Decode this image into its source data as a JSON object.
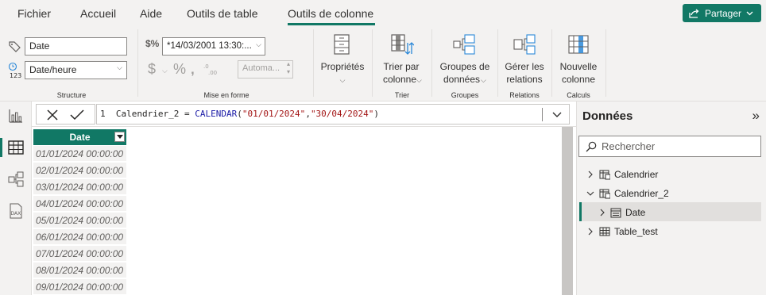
{
  "tabs": [
    "Fichier",
    "Accueil",
    "Aide",
    "Outils de table",
    "Outils de colonne"
  ],
  "share_label": "Partager",
  "structure": {
    "name_value": "Date",
    "type_value": "Date/heure",
    "group_label": "Structure"
  },
  "format": {
    "format_value": "*14/03/2001 13:30:...",
    "decimals_placeholder": "Automa...",
    "group_label": "Mise en forme"
  },
  "ribbon_buttons": {
    "properties": "Propriétés",
    "sort_line1": "Trier par",
    "sort_line2": "colonne",
    "sort_group": "Trier",
    "groups_line1": "Groupes de",
    "groups_line2": "données",
    "groups_group": "Groupes",
    "relations_line1": "Gérer les",
    "relations_line2": "relations",
    "relations_group": "Relations",
    "newcol_line1": "Nouvelle",
    "newcol_line2": "colonne",
    "calc_group": "Calculs"
  },
  "formula": {
    "line_no": "1",
    "prefix": "Calendrier_2 = ",
    "func": "CALENDAR",
    "open": "(",
    "arg1": "\"01/01/2024\"",
    "comma": ",",
    "arg2": "\"30/04/2024\"",
    "close": ")"
  },
  "grid": {
    "column": "Date",
    "rows": [
      "01/01/2024 00:00:00",
      "02/01/2024 00:00:00",
      "03/01/2024 00:00:00",
      "04/01/2024 00:00:00",
      "05/01/2024 00:00:00",
      "06/01/2024 00:00:00",
      "07/01/2024 00:00:00",
      "08/01/2024 00:00:00",
      "09/01/2024 00:00:00"
    ]
  },
  "data_pane": {
    "title": "Données",
    "search_placeholder": "Rechercher",
    "tree": [
      "Calendrier",
      "Calendrier_2",
      "Date",
      "Table_test"
    ]
  },
  "colors": {
    "accent": "#117865"
  }
}
